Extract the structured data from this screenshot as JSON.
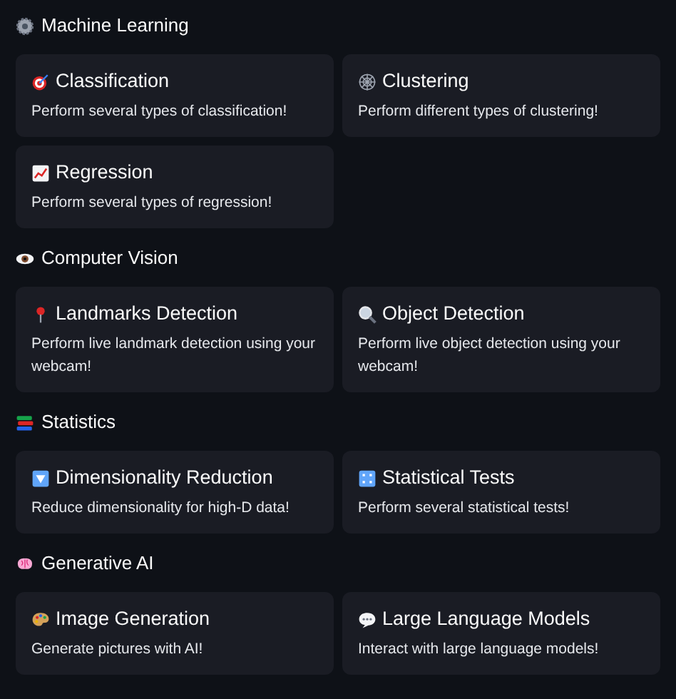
{
  "sections": [
    {
      "title": "Machine Learning",
      "cards": [
        {
          "title": "Classification",
          "description": "Perform several types of classification!"
        },
        {
          "title": "Clustering",
          "description": "Perform different types of clustering!"
        },
        {
          "title": "Regression",
          "description": "Perform several types of regression!"
        }
      ]
    },
    {
      "title": "Computer Vision",
      "cards": [
        {
          "title": "Landmarks Detection",
          "description": "Perform live landmark detection using your webcam!"
        },
        {
          "title": "Object Detection",
          "description": "Perform live object detection using your webcam!"
        }
      ]
    },
    {
      "title": "Statistics",
      "cards": [
        {
          "title": "Dimensionality Reduction",
          "description": "Reduce dimensionality for high-D data!"
        },
        {
          "title": "Statistical Tests",
          "description": "Perform several statistical tests!"
        }
      ]
    },
    {
      "title": "Generative AI",
      "cards": [
        {
          "title": "Image Generation",
          "description": "Generate pictures with AI!"
        },
        {
          "title": "Large Language Models",
          "description": "Interact with large language models!"
        }
      ]
    }
  ]
}
